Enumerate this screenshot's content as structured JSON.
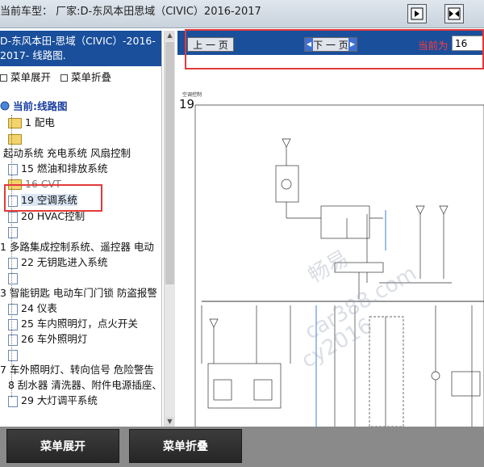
{
  "title_bar": {
    "text": "当前车型：  厂家:D-东风本田思域（CIVIC）2016-2017"
  },
  "left_header": {
    "line1": "D-东风本田-思域（CIVIC）-2016-",
    "line2": "2017- 线路图."
  },
  "options": {
    "expand": "菜单展开",
    "collapse": "菜单折叠"
  },
  "tree": {
    "current": "当前:线路图",
    "items": [
      {
        "label": "1 配电"
      },
      {
        "label": ""
      },
      {
        "label": "起动系统 充电系统 风扇控制"
      },
      {
        "label": "15 燃油和排放系统"
      },
      {
        "label": "16 CVT"
      },
      {
        "label": "19 空调系统"
      },
      {
        "label": "20 HVAC控制"
      },
      {
        "label": ""
      },
      {
        "label": "1 多路集成控制系统、遥控器 电动"
      },
      {
        "label": "22 无钥匙进入系统"
      },
      {
        "label": ""
      },
      {
        "label": "3 智能钥匙 电动车门门锁 防盗报警"
      },
      {
        "label": "24 仪表"
      },
      {
        "label": "25 车内照明灯，点火开关"
      },
      {
        "label": "26 车外照明灯"
      },
      {
        "label": ""
      },
      {
        "label": "7 车外照明灯、转向信号 危险警告"
      },
      {
        "label": "8 刮水器 清洗器、附件电源插座、"
      },
      {
        "label": "29 大灯调平系统"
      }
    ]
  },
  "nav": {
    "prev": "上 一 页",
    "next": "下 一 页",
    "current_label": "当前为",
    "current_page": "16"
  },
  "diagram": {
    "page_number": "19",
    "title": "空调控制",
    "watermark1": "畅易",
    "watermark2": "car388.com",
    "watermark3": "cy2016"
  },
  "bottom": {
    "expand": "菜单展开",
    "collapse": "菜单折叠"
  },
  "colors": {
    "header_blue": "#1a4f9c",
    "highlight_red": "#e23a3a",
    "current_red": "#ff3b3b"
  }
}
